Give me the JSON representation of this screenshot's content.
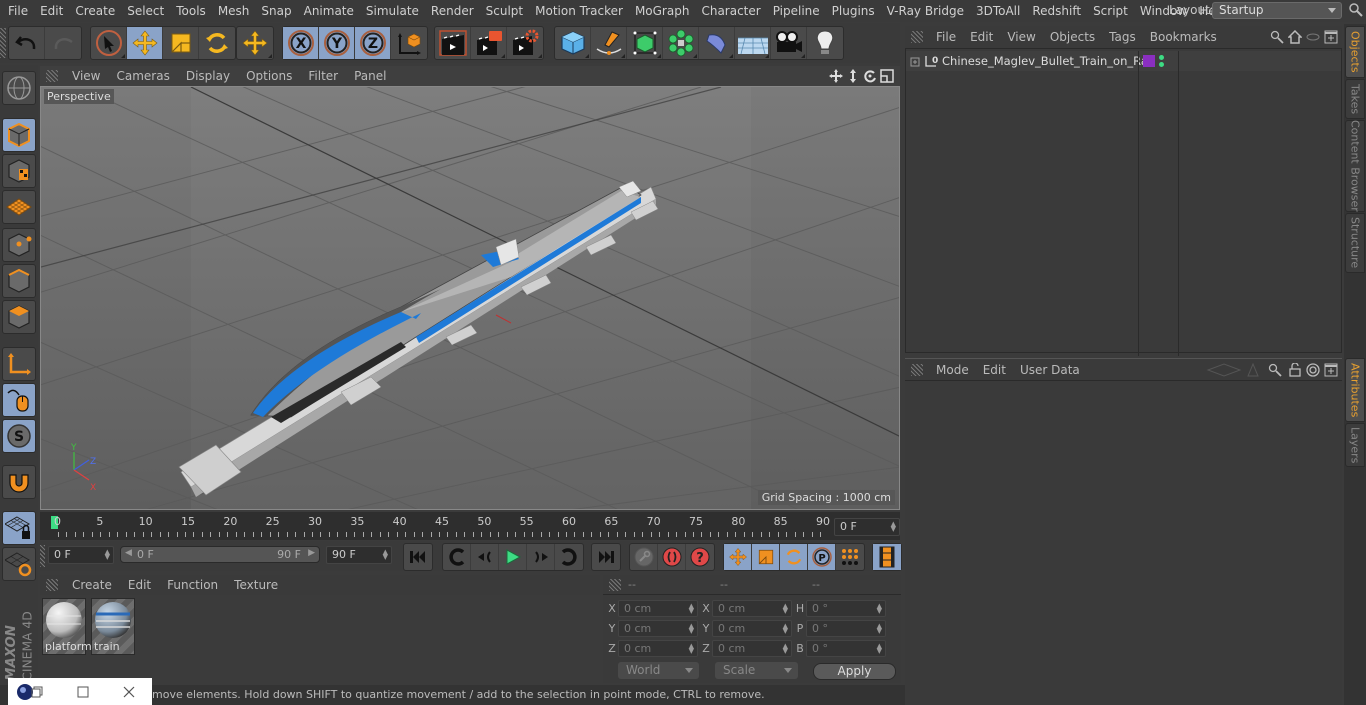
{
  "menubar": {
    "items": [
      "File",
      "Edit",
      "Create",
      "Select",
      "Tools",
      "Mesh",
      "Snap",
      "Animate",
      "Simulate",
      "Render",
      "Sculpt",
      "Motion Tracker",
      "MoGraph",
      "Character",
      "Pipeline",
      "Plugins",
      "V-Ray Bridge",
      "3DToAll",
      "Redshift",
      "Script",
      "Window",
      "Help"
    ],
    "layout_label": "Layout:",
    "layout_value": "Startup"
  },
  "toolbar": {
    "groups": [
      {
        "name": "history",
        "buttons": [
          "undo-icon",
          "redo-icon"
        ]
      },
      {
        "name": "tools",
        "buttons": [
          "live-selection-icon",
          "move-icon",
          "scale-icon",
          "rotate-icon"
        ]
      },
      {
        "name": "recent",
        "buttons": [
          "recent-tool-icon"
        ]
      },
      {
        "name": "axis",
        "buttons": [
          "x-axis-icon",
          "y-axis-icon",
          "z-axis-icon",
          "coordinate-system-icon"
        ]
      },
      {
        "name": "render",
        "buttons": [
          "render-view-icon",
          "render-picture-viewer-icon",
          "render-settings-icon"
        ]
      },
      {
        "name": "create",
        "buttons": [
          "cube-icon",
          "pen-spline-icon",
          "subdivision-icon",
          "cloner-icon",
          "deformer-icon",
          "floor-icon",
          "camera-icon",
          "light-icon"
        ]
      }
    ]
  },
  "left_toolbar": {
    "buttons": [
      "model-mode-icon",
      "texture-mode-icon",
      "workplane-icon",
      "points-mode-icon",
      "edges-mode-icon",
      "polygons-mode-icon",
      "axis-mode-icon",
      "tweak-mode-icon",
      "solo-icon",
      "snap-magnet-icon",
      "workplane-lock-icon",
      "workplane-align-icon"
    ]
  },
  "viewport": {
    "menu": [
      "View",
      "Cameras",
      "Display",
      "Options",
      "Filter",
      "Panel"
    ],
    "camera_label": "Perspective",
    "grid_spacing": "Grid Spacing : 1000 cm",
    "axis_labels": {
      "x": "X",
      "y": "Y",
      "z": "Z"
    }
  },
  "timeline": {
    "ticks": [
      "0",
      "5",
      "10",
      "15",
      "20",
      "25",
      "30",
      "35",
      "40",
      "45",
      "50",
      "55",
      "60",
      "65",
      "70",
      "75",
      "80",
      "85",
      "90"
    ],
    "current_frame": "0 F"
  },
  "transport": {
    "start_field": "0 F",
    "range_start": "0 F",
    "range_end": "90 F",
    "end_field": "90 F"
  },
  "materials": {
    "menu": [
      "Create",
      "Edit",
      "Function",
      "Texture"
    ],
    "items": [
      {
        "name": "platform"
      },
      {
        "name": "train"
      }
    ]
  },
  "coordinates": {
    "headers": [
      "--",
      "--",
      "--"
    ],
    "rows": [
      {
        "a1": "X",
        "v1": "0 cm",
        "a2": "X",
        "v2": "0 cm",
        "a3": "H",
        "v3": "0 °"
      },
      {
        "a1": "Y",
        "v1": "0 cm",
        "a2": "Y",
        "v2": "0 cm",
        "a3": "P",
        "v3": "0 °"
      },
      {
        "a1": "Z",
        "v1": "0 cm",
        "a2": "Z",
        "v2": "0 cm",
        "a3": "B",
        "v3": "0 °"
      }
    ],
    "space_dropdown": "World",
    "mode_dropdown": "Scale",
    "apply_label": "Apply"
  },
  "status": {
    "text": "move elements. Hold down SHIFT to quantize movement / add to the selection in point mode, CTRL to remove."
  },
  "objects_panel": {
    "menu": [
      "File",
      "Edit",
      "View",
      "Objects",
      "Tags",
      "Bookmarks"
    ],
    "objects": [
      {
        "name": "Chinese_Maglev_Bullet_Train_on_Rail",
        "layer_color": "#8a2fc0",
        "dot_color": "#3ddc84"
      }
    ]
  },
  "attributes_panel": {
    "menu": [
      "Mode",
      "Edit",
      "User Data"
    ]
  },
  "side_tabs": {
    "top": [
      {
        "label": "Objects",
        "active": true
      },
      {
        "label": "Takes",
        "active": false
      },
      {
        "label": "Content Browser",
        "active": false
      },
      {
        "label": "Structure",
        "active": false
      }
    ],
    "bottom": [
      {
        "label": "Attributes",
        "active": true
      },
      {
        "label": "Layers",
        "active": false
      }
    ]
  },
  "branding": {
    "maxon": "MAXON",
    "product": "CINEMA 4D"
  },
  "colors": {
    "accent_selected": "#8aa3c8",
    "tab_active": "#e8a030",
    "playhead": "#3ddc84"
  }
}
